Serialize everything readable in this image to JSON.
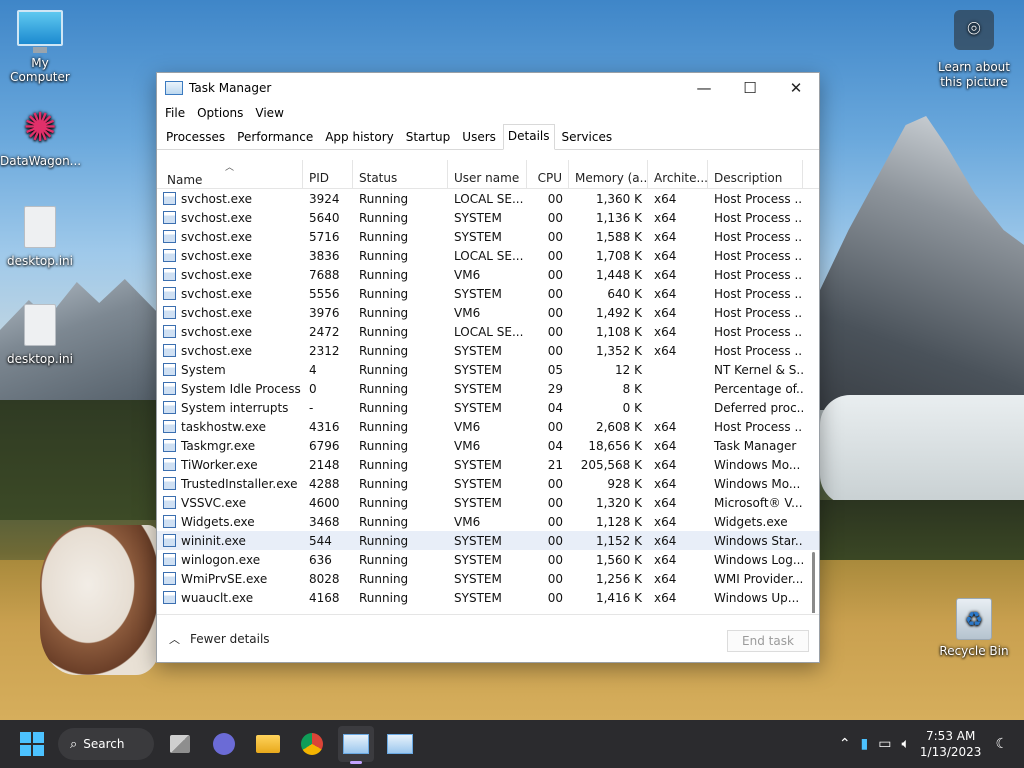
{
  "desktop": {
    "icons": [
      {
        "label": "My Computer"
      },
      {
        "label": "DataWagon..."
      },
      {
        "label": "desktop.ini"
      },
      {
        "label": "desktop.ini"
      },
      {
        "label": "Learn about this picture"
      },
      {
        "label": "Recycle Bin"
      }
    ]
  },
  "window": {
    "title": "Task Manager",
    "controls": {
      "minimize": "—",
      "maximize": "☐",
      "close": "✕"
    },
    "menu": [
      "File",
      "Options",
      "View"
    ],
    "tabs": [
      "Processes",
      "Performance",
      "App history",
      "Startup",
      "Users",
      "Details",
      "Services"
    ],
    "active_tab": "Details",
    "columns": [
      "Name",
      "PID",
      "Status",
      "User name",
      "CPU",
      "Memory (a...",
      "Archite...",
      "Description"
    ],
    "rows": [
      [
        "svchost.exe",
        "3924",
        "Running",
        "LOCAL SE...",
        "00",
        "1,360 K",
        "x64",
        "Host Process ..."
      ],
      [
        "svchost.exe",
        "5640",
        "Running",
        "SYSTEM",
        "00",
        "1,136 K",
        "x64",
        "Host Process ..."
      ],
      [
        "svchost.exe",
        "5716",
        "Running",
        "SYSTEM",
        "00",
        "1,588 K",
        "x64",
        "Host Process ..."
      ],
      [
        "svchost.exe",
        "3836",
        "Running",
        "LOCAL SE...",
        "00",
        "1,708 K",
        "x64",
        "Host Process ..."
      ],
      [
        "svchost.exe",
        "7688",
        "Running",
        "VM6",
        "00",
        "1,448 K",
        "x64",
        "Host Process ..."
      ],
      [
        "svchost.exe",
        "5556",
        "Running",
        "SYSTEM",
        "00",
        "640 K",
        "x64",
        "Host Process ..."
      ],
      [
        "svchost.exe",
        "3976",
        "Running",
        "VM6",
        "00",
        "1,492 K",
        "x64",
        "Host Process ..."
      ],
      [
        "svchost.exe",
        "2472",
        "Running",
        "LOCAL SE...",
        "00",
        "1,108 K",
        "x64",
        "Host Process ..."
      ],
      [
        "svchost.exe",
        "2312",
        "Running",
        "SYSTEM",
        "00",
        "1,352 K",
        "x64",
        "Host Process ..."
      ],
      [
        "System",
        "4",
        "Running",
        "SYSTEM",
        "05",
        "12 K",
        "",
        "NT Kernel & S..."
      ],
      [
        "System Idle Process",
        "0",
        "Running",
        "SYSTEM",
        "29",
        "8 K",
        "",
        "Percentage of..."
      ],
      [
        "System interrupts",
        "-",
        "Running",
        "SYSTEM",
        "04",
        "0 K",
        "",
        "Deferred proc..."
      ],
      [
        "taskhostw.exe",
        "4316",
        "Running",
        "VM6",
        "00",
        "2,608 K",
        "x64",
        "Host Process ..."
      ],
      [
        "Taskmgr.exe",
        "6796",
        "Running",
        "VM6",
        "04",
        "18,656 K",
        "x64",
        "Task Manager"
      ],
      [
        "TiWorker.exe",
        "2148",
        "Running",
        "SYSTEM",
        "21",
        "205,568 K",
        "x64",
        "Windows Mo..."
      ],
      [
        "TrustedInstaller.exe",
        "4288",
        "Running",
        "SYSTEM",
        "00",
        "928 K",
        "x64",
        "Windows Mo..."
      ],
      [
        "VSSVC.exe",
        "4600",
        "Running",
        "SYSTEM",
        "00",
        "1,320 K",
        "x64",
        "Microsoft® V..."
      ],
      [
        "Widgets.exe",
        "3468",
        "Running",
        "VM6",
        "00",
        "1,128 K",
        "x64",
        "Widgets.exe"
      ],
      [
        "wininit.exe",
        "544",
        "Running",
        "SYSTEM",
        "00",
        "1,152 K",
        "x64",
        "Windows Star..."
      ],
      [
        "winlogon.exe",
        "636",
        "Running",
        "SYSTEM",
        "00",
        "1,560 K",
        "x64",
        "Windows Log..."
      ],
      [
        "WmiPrvSE.exe",
        "8028",
        "Running",
        "SYSTEM",
        "00",
        "1,256 K",
        "x64",
        "WMI Provider..."
      ],
      [
        "wuauclt.exe",
        "4168",
        "Running",
        "SYSTEM",
        "00",
        "1,416 K",
        "x64",
        "Windows Up..."
      ]
    ],
    "highlighted_row": 18,
    "footer": {
      "fewer_details": "Fewer details",
      "end_task": "End task"
    }
  },
  "taskbar": {
    "search_label": "Search",
    "time": "7:53 AM",
    "date": "1/13/2023"
  },
  "colors": {
    "accent": "#4cc2ff",
    "taskbar": "#2b2b2e",
    "row_highlight": "#e8eef8"
  }
}
